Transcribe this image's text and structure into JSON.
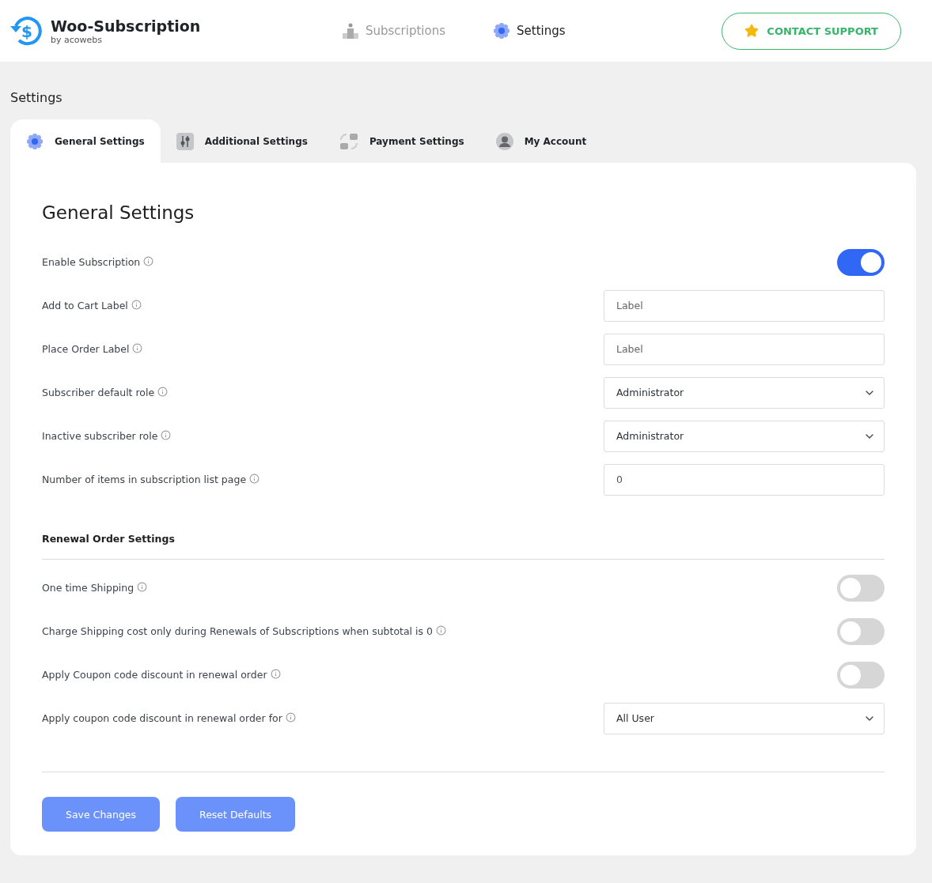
{
  "header": {
    "logo_mark": "$",
    "brand": "Woo-Subscription",
    "byline": "by acowebs",
    "nav": [
      {
        "label": "Subscriptions",
        "selected": false
      },
      {
        "label": "Settings",
        "selected": true
      }
    ],
    "support_button": "CONTACT SUPPORT"
  },
  "page_title": "Settings",
  "tabs": [
    {
      "label": "General Settings",
      "selected": true
    },
    {
      "label": "Additional Settings",
      "selected": false
    },
    {
      "label": "Payment Settings",
      "selected": false
    },
    {
      "label": "My Account",
      "selected": false
    }
  ],
  "card_title": "General Settings",
  "general_rows": [
    {
      "kind": "toggle",
      "label": "Enable Subscription",
      "on": true
    },
    {
      "kind": "text",
      "label": "Add to Cart Label",
      "placeholder": "Label"
    },
    {
      "kind": "text",
      "label": "Place Order Label",
      "placeholder": "Label"
    },
    {
      "kind": "select",
      "label": "Subscriber default role",
      "value": "Administrator"
    },
    {
      "kind": "select",
      "label": "Inactive subscriber role",
      "value": "Administrator"
    },
    {
      "kind": "text",
      "label": "Number of items in subscription list page",
      "value": "0"
    }
  ],
  "section_title": "Renewal Order Settings",
  "renewal_rows": [
    {
      "kind": "toggle",
      "label": "One time Shipping",
      "on": false
    },
    {
      "kind": "toggle",
      "label": "Charge Shipping cost only during Renewals of Subscriptions when subtotal is 0",
      "on": false
    },
    {
      "kind": "toggle",
      "label": "Apply Coupon code discount in renewal order",
      "on": false
    },
    {
      "kind": "select",
      "label": "Apply coupon code discount in renewal order for",
      "value": "All User"
    }
  ],
  "buttons": [
    "Save Changes",
    "Reset Defaults"
  ]
}
